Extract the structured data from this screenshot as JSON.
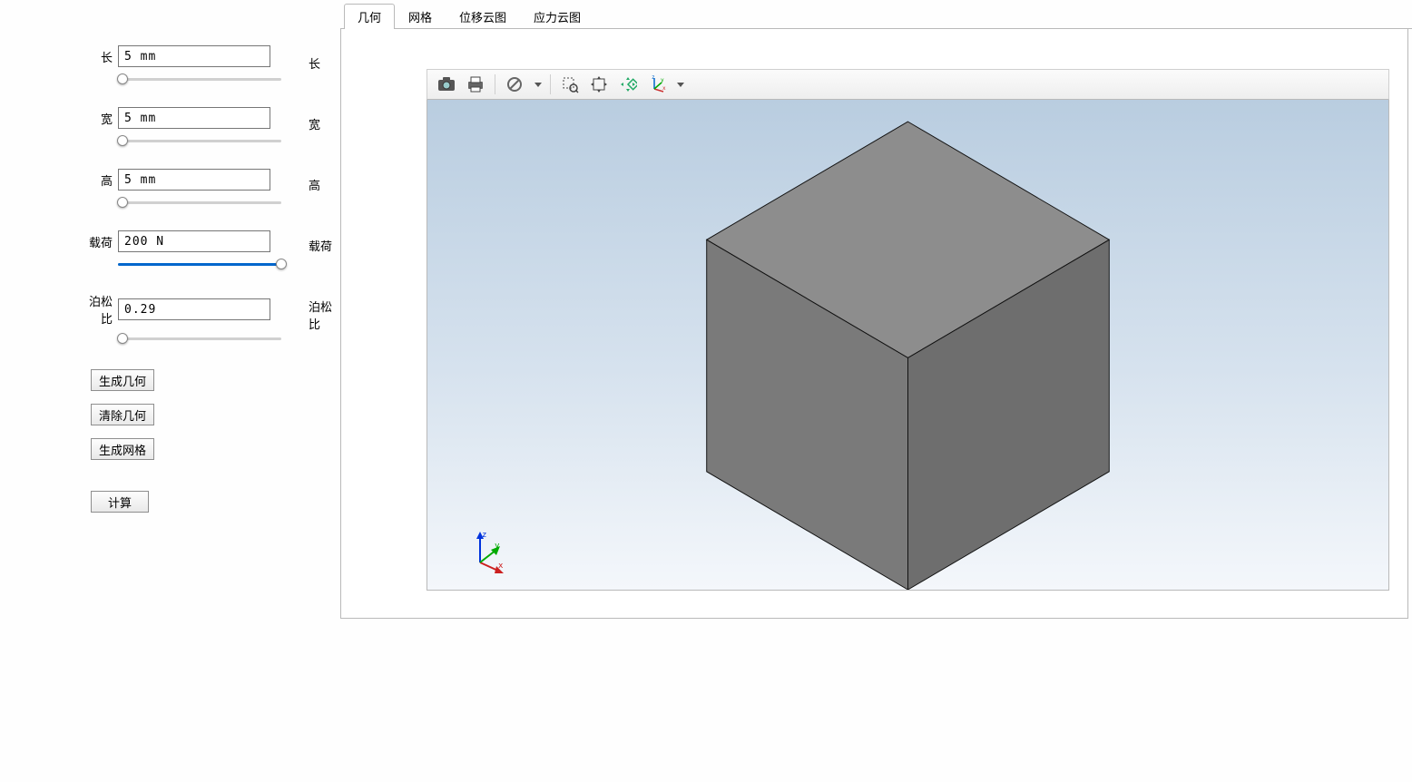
{
  "sidebar": {
    "params": [
      {
        "label": "长",
        "value": "5 mm",
        "slider_percent": 3
      },
      {
        "label": "宽",
        "value": "5 mm",
        "slider_percent": 3
      },
      {
        "label": "高",
        "value": "5 mm",
        "slider_percent": 3
      },
      {
        "label": "载荷",
        "value": "200 N",
        "slider_percent": 100
      },
      {
        "label": "泊松比",
        "value": "0.29",
        "slider_percent": 3
      }
    ],
    "echo_labels": [
      "长",
      "宽",
      "高",
      "载荷",
      "泊松比"
    ],
    "buttons": {
      "generate_geometry": "生成几何",
      "clear_geometry": "清除几何",
      "generate_mesh": "生成网格",
      "calculate": "计算"
    }
  },
  "tabs": {
    "items": [
      {
        "label": "几何",
        "active": true
      },
      {
        "label": "网格",
        "active": false
      },
      {
        "label": "位移云图",
        "active": false
      },
      {
        "label": "应力云图",
        "active": false
      }
    ]
  },
  "viewer_toolbar": {
    "icons": [
      "camera-icon",
      "printer-icon",
      "|",
      "nil-icon",
      "dropdown",
      "|",
      "zoom-select-icon",
      "pan-icon",
      "fit-all-icon",
      "axis-icon",
      "dropdown"
    ]
  },
  "triad_labels": {
    "x": "x",
    "y": "y",
    "z": "z"
  },
  "colors": {
    "slider_fill": "#0066cc",
    "cube_top": "#8d8d8d",
    "cube_left": "#7a7a7a",
    "cube_right": "#6e6e6e",
    "sky_top": "#b9cde0",
    "sky_bottom": "#f4f7fb"
  }
}
